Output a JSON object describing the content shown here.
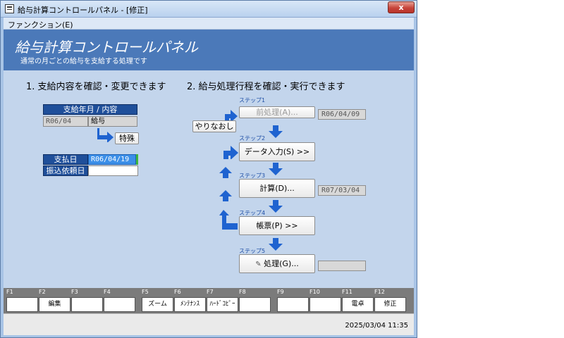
{
  "window": {
    "title": "給与計算コントロールパネル - [修正]",
    "close_label": "x"
  },
  "menu": {
    "function_label": "ファンクション(E)"
  },
  "header": {
    "title": "給与計算コントロールパネル",
    "subtitle": "通常の月ごとの給与を支給する処理です"
  },
  "sections": {
    "left_heading": "1. 支給内容を確認・変更できます",
    "right_heading": "2. 給与処理行程を確認・実行できます"
  },
  "left": {
    "ym_label": "支給年月 / 内容",
    "ym_value": "R06/04",
    "content_value": "給与",
    "special_button": "特殊",
    "payday_label": "支払日",
    "payday_value": "R06/04/19",
    "transfer_label": "振込依頼日",
    "transfer_value": ""
  },
  "steps": {
    "redo_button": "やりなおし",
    "step1_label": "ステップ1",
    "step1_button": "前処理(A)...",
    "step1_date": "R06/04/09",
    "step2_label": "ステップ2",
    "step2_button": "データ入力(S) >>",
    "step3_label": "ステップ3",
    "step3_button": "計算(D)...",
    "step3_date": "R07/03/04",
    "step4_label": "ステップ4",
    "step4_button": "帳票(P) >>",
    "step5_label": "ステップ5",
    "step5_button": "処理(G)...",
    "step5_date": ""
  },
  "fkeys": [
    {
      "num": "F1",
      "label": ""
    },
    {
      "num": "F2",
      "label": "編集"
    },
    {
      "num": "F3",
      "label": ""
    },
    {
      "num": "F4",
      "label": ""
    },
    {
      "num": "F5",
      "label": "ズーム"
    },
    {
      "num": "F6",
      "label": "ﾒﾝﾃﾅﾝｽ"
    },
    {
      "num": "F7",
      "label": "ﾊｰﾄﾞｺﾋﾟｰ"
    },
    {
      "num": "F8",
      "label": ""
    },
    {
      "num": "F9",
      "label": ""
    },
    {
      "num": "F10",
      "label": ""
    },
    {
      "num": "F11",
      "label": "電卓"
    },
    {
      "num": "F12",
      "label": "修正"
    }
  ],
  "status": {
    "datetime": "2025/03/04  11:35"
  },
  "colors": {
    "header": "#4b79b9",
    "arrow": "#1f63d0",
    "label_bg": "#1f4f9a"
  }
}
